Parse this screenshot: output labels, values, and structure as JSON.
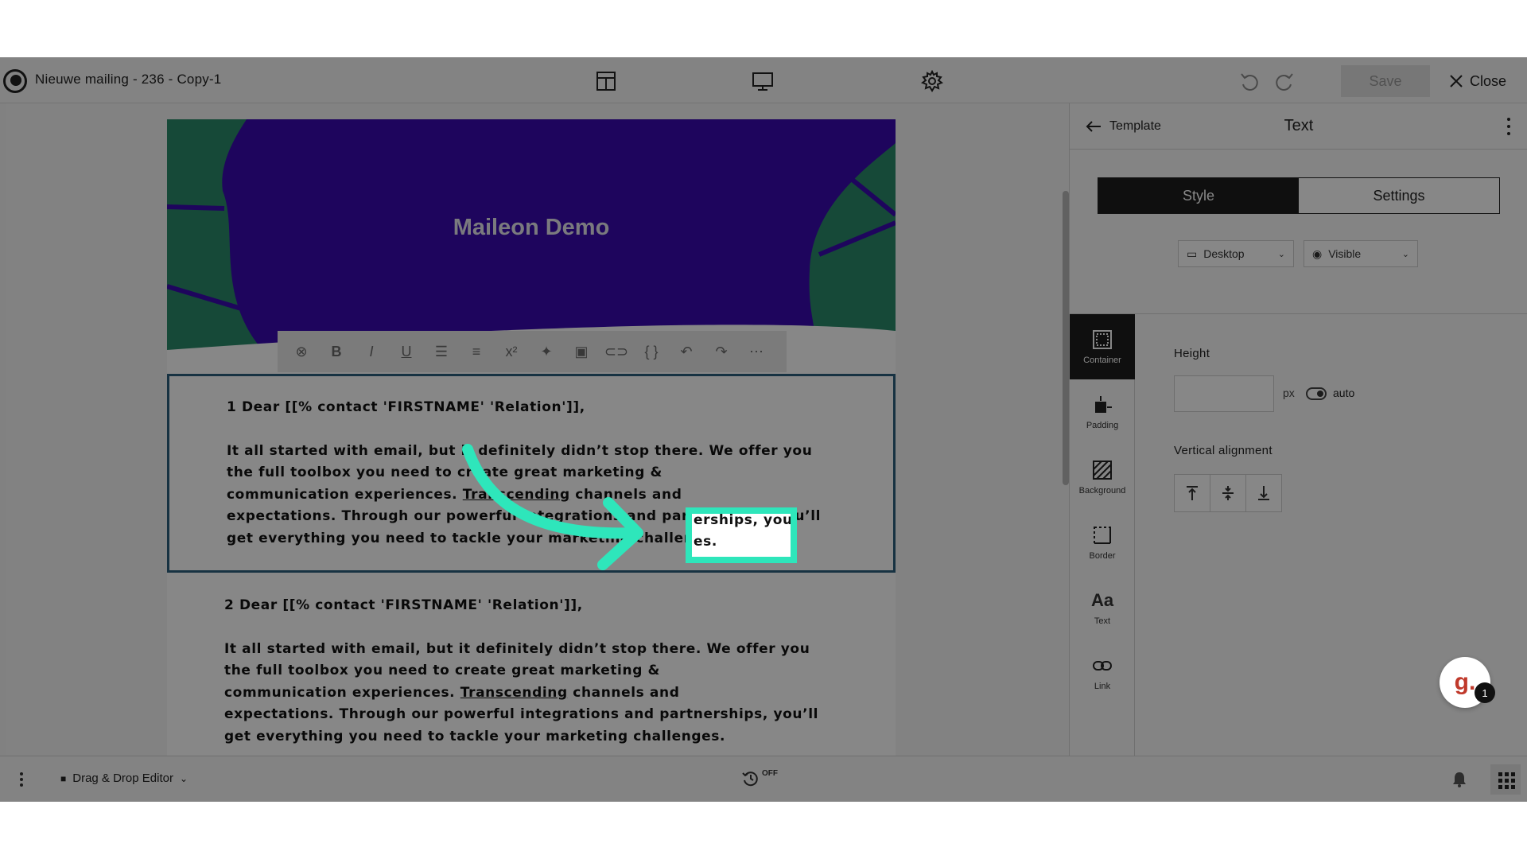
{
  "app": {
    "doc_title": "Nieuwe mailing - 236 - Copy-1",
    "save_label": "Save",
    "close_label": "Close"
  },
  "email": {
    "banner_title": "Maileon Demo",
    "block1": {
      "greeting": "1 Dear [[% contact 'FIRSTNAME' 'Relation']],",
      "line1": "It all started with email, but it definitely didn’t stop there. We offer you",
      "line2": "the full toolbox you need to create great marketing &",
      "line3_pre": "communication experiences. ",
      "line3_link": "Transcending",
      "line3_post": " channels and",
      "line4": "expectations. Through our powerful integrations and partnerships, you’ll",
      "line5": "get everything you need to tackle your marketing challenges."
    },
    "block2": {
      "greeting": "2 Dear [[% contact 'FIRSTNAME' 'Relation']],",
      "line1": "It all started with email, but it definitely didn’t stop there. We offer you",
      "line2": "the full toolbox you need to create great marketing &",
      "line3_pre": "communication experiences. ",
      "line3_link": "Transcending",
      "line3_post": " channels and",
      "line4": "expectations. Through our powerful integrations and partnerships, you’ll",
      "line5": "get everything you need to tackle your marketing challenges."
    },
    "highlight": {
      "top_text": "erships, you'll",
      "bottom_text": "es."
    }
  },
  "panel": {
    "back_label": "Template",
    "title": "Text",
    "tabs": [
      "Style",
      "Settings"
    ],
    "device_dropdown": "Desktop",
    "visibility_dropdown": "Visible",
    "nav": [
      "Container",
      "Padding",
      "Background",
      "Border",
      "Text",
      "Link"
    ],
    "text_nav_glyph": "Aa",
    "height_label": "Height",
    "height_unit": "px",
    "auto_label": "auto",
    "valign_label": "Vertical alignment"
  },
  "bottom": {
    "editor_mode": "Drag & Drop Editor",
    "autosave_state": "OFF",
    "chat_glyph": "g.",
    "notification_count": "1"
  },
  "colors": {
    "banner_bg": "#3a0bb0",
    "banner_leaf": "#2a8a6b",
    "selection_border": "#2c5f7e",
    "highlight": "#2ee6bb"
  }
}
